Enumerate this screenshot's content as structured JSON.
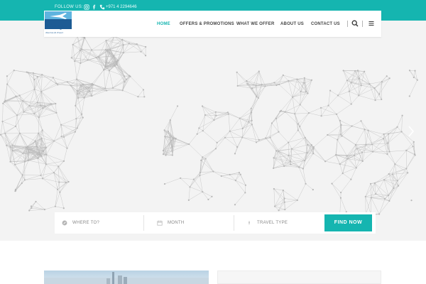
{
  "topbar": {
    "follow_label": "FOLLOW US:",
    "phone": "+971 4 2294646",
    "icons": [
      "instagram-icon",
      "facebook-icon",
      "phone-icon"
    ],
    "color": "#15b5b0"
  },
  "logo": {
    "brand": "Mazaya",
    "tagline": "Tourism & Travel"
  },
  "nav": {
    "items": [
      {
        "label": "HOME",
        "active": true
      },
      {
        "label": "OFFERS & PROMOTIONS",
        "active": false
      },
      {
        "label": "WHAT WE OFFER",
        "active": false
      },
      {
        "label": "ABOUT US",
        "active": false
      },
      {
        "label": "CONTACT US",
        "active": false
      }
    ],
    "icons": [
      "search-icon",
      "menu-icon"
    ]
  },
  "search": {
    "where_placeholder": "WHERE TO?",
    "month_placeholder": "MONTH",
    "type_placeholder": "TRAVEL TYPE",
    "button_label": "FIND NOW",
    "icons": [
      "location-icon",
      "calendar-icon",
      "travel-type-icon"
    ]
  },
  "colors": {
    "accent": "#15b5b0",
    "hero_bg": "#f3f3f3",
    "map_dots": "#b8b8b8"
  }
}
